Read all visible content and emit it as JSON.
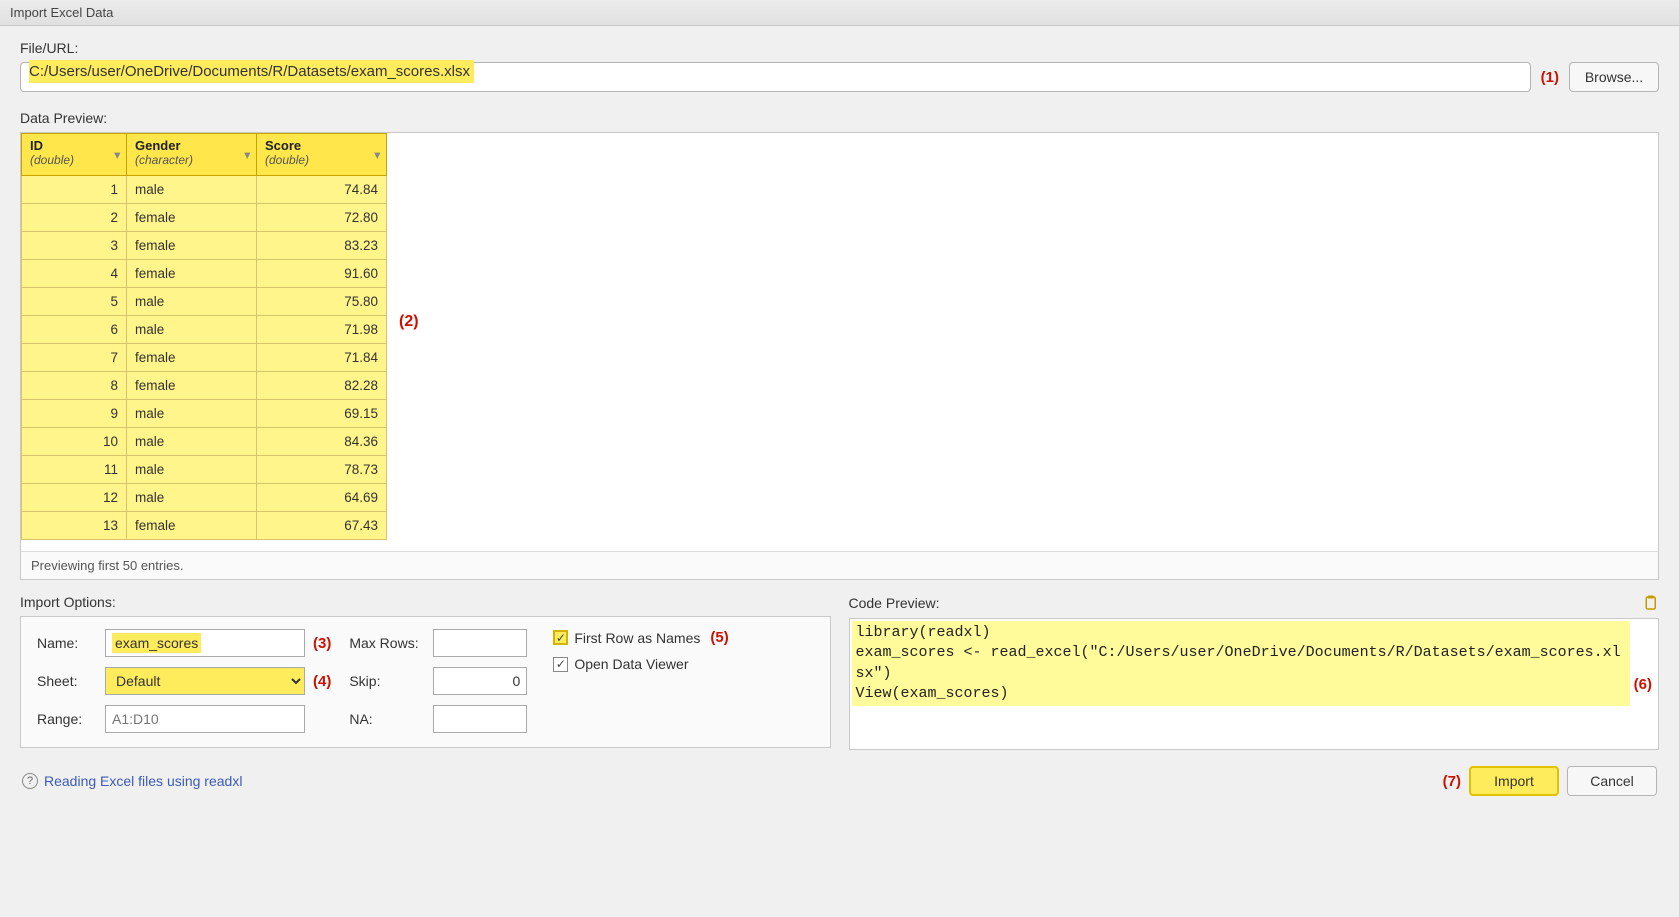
{
  "window_title": "Import Excel Data",
  "file_url_label": "File/URL:",
  "file_url_value": "C:/Users/user/OneDrive/Documents/R/Datasets/exam_scores.xlsx",
  "browse_label": "Browse...",
  "data_preview_label": "Data Preview:",
  "preview_status": "Previewing first 50 entries.",
  "columns": [
    {
      "name": "ID",
      "type": "(double)"
    },
    {
      "name": "Gender",
      "type": "(character)"
    },
    {
      "name": "Score",
      "type": "(double)"
    }
  ],
  "rows": [
    {
      "id": "1",
      "gender": "male",
      "score": "74.84"
    },
    {
      "id": "2",
      "gender": "female",
      "score": "72.80"
    },
    {
      "id": "3",
      "gender": "female",
      "score": "83.23"
    },
    {
      "id": "4",
      "gender": "female",
      "score": "91.60"
    },
    {
      "id": "5",
      "gender": "male",
      "score": "75.80"
    },
    {
      "id": "6",
      "gender": "male",
      "score": "71.98"
    },
    {
      "id": "7",
      "gender": "female",
      "score": "71.84"
    },
    {
      "id": "8",
      "gender": "female",
      "score": "82.28"
    },
    {
      "id": "9",
      "gender": "male",
      "score": "69.15"
    },
    {
      "id": "10",
      "gender": "male",
      "score": "84.36"
    },
    {
      "id": "11",
      "gender": "male",
      "score": "78.73"
    },
    {
      "id": "12",
      "gender": "male",
      "score": "64.69"
    },
    {
      "id": "13",
      "gender": "female",
      "score": "67.43"
    }
  ],
  "import_options_label": "Import Options:",
  "code_preview_label": "Code Preview:",
  "options": {
    "name_label": "Name:",
    "name_value": "exam_scores",
    "sheet_label": "Sheet:",
    "sheet_value": "Default",
    "range_label": "Range:",
    "range_placeholder": "A1:D10",
    "maxrows_label": "Max Rows:",
    "maxrows_value": "",
    "skip_label": "Skip:",
    "skip_value": "0",
    "na_label": "NA:",
    "na_value": "",
    "firstrow_label": "First Row as Names",
    "firstrow_checked": true,
    "opendata_label": "Open Data Viewer",
    "opendata_checked": true
  },
  "code_preview": "library(readxl)\nexam_scores <- read_excel(\"C:/Users/user/OneDrive/Documents/R/Datasets/exam_scores.xlsx\")\nView(exam_scores)",
  "help_text": "Reading Excel files using readxl",
  "import_button": "Import",
  "cancel_button": "Cancel",
  "annotations": {
    "a1": "(1)",
    "a2": "(2)",
    "a3": "(3)",
    "a4": "(4)",
    "a5": "(5)",
    "a6": "(6)",
    "a7": "(7)"
  }
}
